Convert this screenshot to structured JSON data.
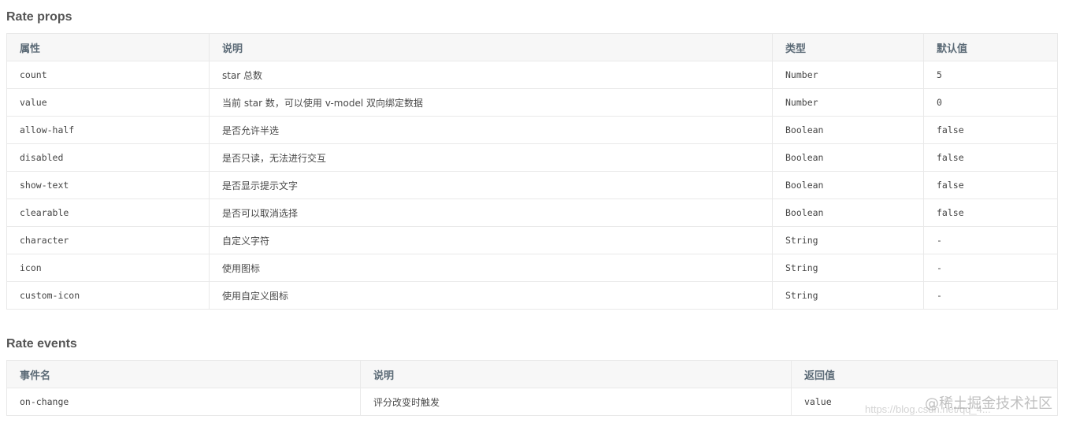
{
  "props": {
    "title": "Rate props",
    "headers": [
      "属性",
      "说明",
      "类型",
      "默认值"
    ],
    "rows": [
      [
        "count",
        "star 总数",
        "Number",
        "5"
      ],
      [
        "value",
        "当前 star 数，可以使用 v-model 双向绑定数据",
        "Number",
        "0"
      ],
      [
        "allow-half",
        "是否允许半选",
        "Boolean",
        "false"
      ],
      [
        "disabled",
        "是否只读，无法进行交互",
        "Boolean",
        "false"
      ],
      [
        "show-text",
        "是否显示提示文字",
        "Boolean",
        "false"
      ],
      [
        "clearable",
        "是否可以取消选择",
        "Boolean",
        "false"
      ],
      [
        "character",
        "自定义字符",
        "String",
        "-"
      ],
      [
        "icon",
        "使用图标",
        "String",
        "-"
      ],
      [
        "custom-icon",
        "使用自定义图标",
        "String",
        "-"
      ]
    ]
  },
  "events": {
    "title": "Rate events",
    "headers": [
      "事件名",
      "说明",
      "返回值"
    ],
    "rows": [
      [
        "on-change",
        "评分改变时触发",
        "value"
      ]
    ]
  },
  "watermark": {
    "brand": "@稀土掘金技术社区",
    "url": "https://blog.csdn.net/qq_4..."
  }
}
